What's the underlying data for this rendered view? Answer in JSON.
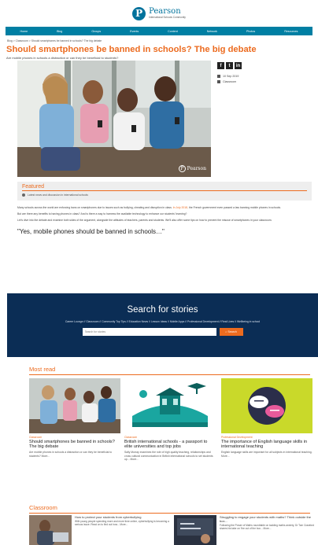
{
  "header": {
    "logo_letter": "P",
    "brand": "Pearson",
    "tagline": "International Schools Community"
  },
  "nav": [
    "Home",
    "Blog",
    "Groups",
    "Events",
    "Content",
    "Network",
    "Photos",
    "Resources"
  ],
  "breadcrumb": "Blog > Classroom > Should smartphones be banned in schools? The big debate",
  "article": {
    "title": "Should smartphones be banned in schools? The big debate",
    "subtitle": "Are mobile phones in schools a distraction or can they be beneficial to students?",
    "hero_brand": "Pearson",
    "date": "10 Sep 2019",
    "category": "Classroom",
    "featured_title": "Featured",
    "featured_line": "Latest news and discussion in international schools",
    "para1": "Many schools across the world are enforcing bans on smartphones due to issues such as bullying, cheating and disruption in class.",
    "para1_link": "In July 2018,",
    "para1_end": "the French government even passed a law banning mobile phones in schools.",
    "para2": "But are there any benefits to having phones in class? And is there a way to harness the available technology to enhance our students' learning?",
    "para3": "Let's dive into the debate and examine both sides of the argument, alongside the attitudes of teachers, parents and students. We'll also offer some tips on how to prevent the misuse of smartphones in your classroom.",
    "quote": "\"Yes, mobile phones should be banned in schools…\""
  },
  "search": {
    "title": "Search for stories",
    "categories": "Career Lounge  //  Classroom  //  Community Top Tips  //  Education News  //  Lesson Ideas  //  Mobile Apps  //  Professional Development  //  Real Lives  //  Wellbeing in school",
    "placeholder": "Search for stories",
    "button": "Search"
  },
  "most_read": {
    "heading": "Most read",
    "cards": [
      {
        "category": "Classroom",
        "title": "Should smartphones be banned in schools? The big debate",
        "desc": "Are mobile phones in schools a distraction or can they be beneficial to students? More..."
      },
      {
        "category": "Classroom",
        "title": "British international schools - a passport to elite universities and top jobs",
        "desc": "Sally Murray examines the role of high quality teaching, relationships and cross cultural communication in British international schools to set students up... More..."
      },
      {
        "category": "Professional Development",
        "title": "The importance of English language skills in international teaching",
        "desc": "English language skills are important for all subjects in international teaching. More..."
      }
    ]
  },
  "classroom": {
    "heading": "Classroom",
    "items": [
      {
        "title": "How to protect your students from cyberbullying",
        "desc": "With young people spending more and more time online, cyberbullying is becoming a serious issue. Read on to find out how... More..."
      },
      {
        "title": "Struggling to engage your students with maths? Think outside the box...",
        "desc": "Following the Power of Maths roundtable on tackling maths anxiety, Dr Tom Crawford shares his take on 'the out of the box... More..."
      }
    ]
  },
  "colors": {
    "accent": "#ec6b1f",
    "nav": "#007fa3",
    "search_bg": "#0b2d55",
    "brand": "#00729c"
  }
}
